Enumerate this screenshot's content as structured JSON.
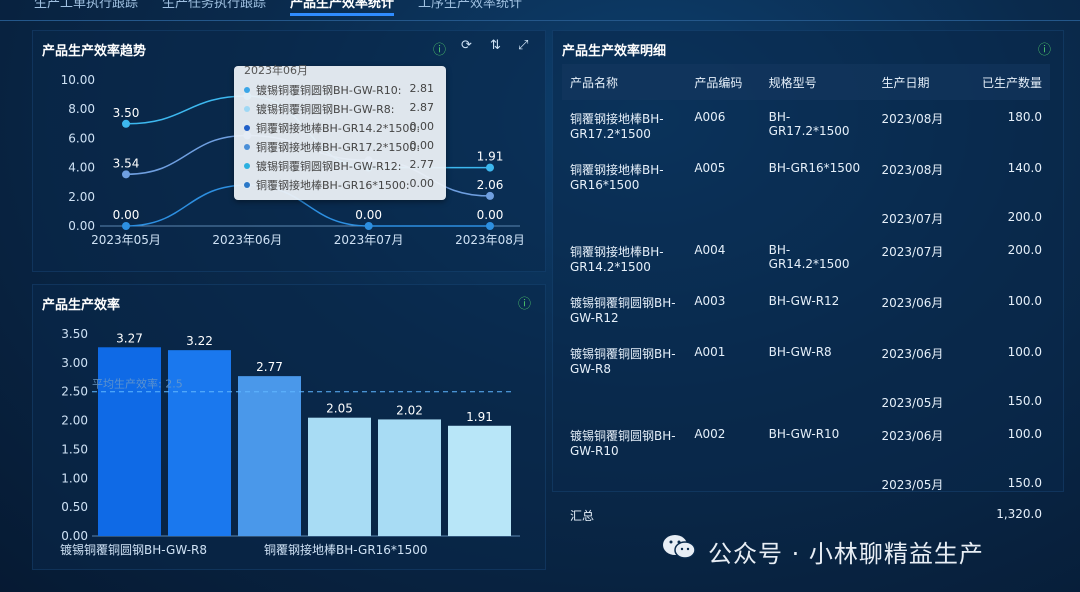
{
  "nav": {
    "tabs": [
      "生产工单执行跟踪",
      "生产任务执行跟踪",
      "产品生产效率统计",
      "工序生产效率统计"
    ],
    "active_index": 2
  },
  "trend_panel": {
    "title": "产品生产效率趋势",
    "icons": [
      "info-icon",
      "refresh-icon",
      "sort-icon",
      "fullscreen-icon"
    ]
  },
  "tooltip": {
    "header": "2023年06月",
    "rows": [
      {
        "name": "镀锡铜覆铜圆钢BH-GW-R10:",
        "value": "2.81",
        "color": "#3aa6e8"
      },
      {
        "name": "镀锡铜覆铜圆钢BH-GW-R8:",
        "value": "2.87",
        "color": "#9fd8f5"
      },
      {
        "name": "铜覆钢接地棒BH-GR14.2*1500:",
        "value": "0.00",
        "color": "#1f5fc8"
      },
      {
        "name": "铜覆钢接地棒BH-GR17.2*1500:",
        "value": "0.00",
        "color": "#4a8fd8"
      },
      {
        "name": "镀锡铜覆铜圆钢BH-GW-R12:",
        "value": "2.77",
        "color": "#2bb0e0"
      },
      {
        "name": "铜覆钢接地棒BH-GR16*1500:",
        "value": "0.00",
        "color": "#2a78c8"
      }
    ]
  },
  "chart_data": [
    {
      "type": "line",
      "x": [
        "2023年05月",
        "2023年06月",
        "2023年07月",
        "2023年08月"
      ],
      "ylim": [
        0,
        10
      ],
      "yticks": [
        "0.00",
        "2.00",
        "4.00",
        "6.00",
        "8.00",
        "10.00"
      ],
      "series": [
        {
          "values": [
            7.0,
            8.9,
            4.0,
            4.0
          ],
          "color": "#3db8ef"
        },
        {
          "values": [
            3.54,
            6.2,
            4.5,
            2.06
          ],
          "color": "#6f9fe0"
        },
        {
          "values": [
            0.0,
            2.8,
            0.0,
            0.0
          ],
          "color": "#2d8fe0"
        }
      ],
      "data_labels": [
        {
          "series": 0,
          "index": 0,
          "text": "3.50"
        },
        {
          "series": 1,
          "index": 0,
          "text": "3.54"
        },
        {
          "series": 2,
          "index": 0,
          "text": "0.00"
        },
        {
          "series": 2,
          "index": 2,
          "text": "0.00"
        },
        {
          "series": 2,
          "index": 3,
          "text": "0.00"
        },
        {
          "series": 0,
          "index": 3,
          "text": "1.91"
        },
        {
          "series": 1,
          "index": 3,
          "text": "2.06"
        }
      ]
    },
    {
      "type": "bar",
      "title": "产品生产效率",
      "categories": [
        "镀锡铜覆铜圆钢BH-GW-R8",
        "",
        "",
        "铜覆钢接地棒BH-GR16*1500",
        "",
        ""
      ],
      "values": [
        3.27,
        3.22,
        2.77,
        2.05,
        2.02,
        1.91
      ],
      "value_labels": [
        "3.27",
        "3.22",
        "2.77",
        "2.05",
        "2.02",
        "1.91"
      ],
      "colors": [
        "#0f6ae6",
        "#1a78ee",
        "#4a98ea",
        "#a8dcf4",
        "#a8dcf4",
        "#b8e6f8"
      ],
      "ylim": [
        0,
        3.5
      ],
      "yticks": [
        "0.00",
        "0.50",
        "1.00",
        "1.50",
        "2.00",
        "2.50",
        "3.00",
        "3.50"
      ],
      "reference_line": {
        "value": 2.5,
        "label": "平均生产效率: 2.5"
      }
    }
  ],
  "detail_panel": {
    "title": "产品生产效率明细",
    "columns": [
      "产品名称",
      "产品编码",
      "规格型号",
      "生产日期",
      "已生产数量"
    ],
    "groups": [
      {
        "name": "铜覆钢接地棒BH-GR17.2*1500",
        "code": "A006",
        "spec": "BH-GR17.2*1500",
        "rows": [
          {
            "date": "2023/08月",
            "qty": "180.0"
          }
        ]
      },
      {
        "name": "铜覆钢接地棒BH-GR16*1500",
        "code": "A005",
        "spec": "BH-GR16*1500",
        "rows": [
          {
            "date": "2023/08月",
            "qty": "140.0"
          },
          {
            "date": "2023/07月",
            "qty": "200.0"
          }
        ]
      },
      {
        "name": "铜覆钢接地棒BH-GR14.2*1500",
        "code": "A004",
        "spec": "BH-GR14.2*1500",
        "rows": [
          {
            "date": "2023/07月",
            "qty": "200.0"
          }
        ]
      },
      {
        "name": "镀锡铜覆铜圆钢BH-GW-R12",
        "code": "A003",
        "spec": "BH-GW-R12",
        "rows": [
          {
            "date": "2023/06月",
            "qty": "100.0"
          }
        ]
      },
      {
        "name": "镀锡铜覆铜圆钢BH-GW-R8",
        "code": "A001",
        "spec": "BH-GW-R8",
        "rows": [
          {
            "date": "2023/06月",
            "qty": "100.0"
          },
          {
            "date": "2023/05月",
            "qty": "150.0"
          }
        ]
      },
      {
        "name": "镀锡铜覆铜圆钢BH-GW-R10",
        "code": "A002",
        "spec": "BH-GW-R10",
        "rows": [
          {
            "date": "2023/06月",
            "qty": "100.0"
          },
          {
            "date": "2023/05月",
            "qty": "150.0"
          }
        ]
      }
    ],
    "total_label": "汇总",
    "total_value": "1,320.0"
  },
  "watermark": {
    "text": "公众号 · 小林聊精益生产"
  }
}
